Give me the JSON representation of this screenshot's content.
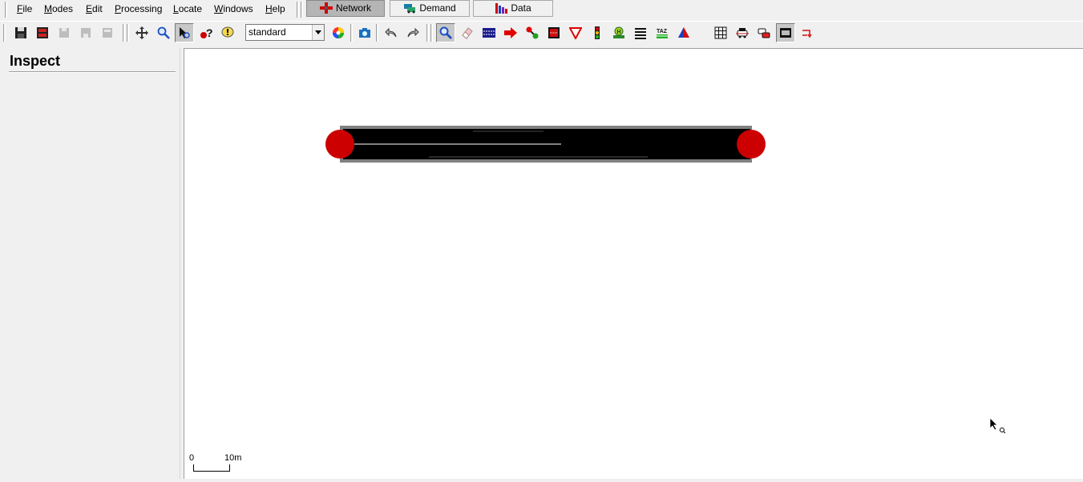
{
  "menu": {
    "items": [
      {
        "label": "File",
        "u": "F",
        "rest": "ile"
      },
      {
        "label": "Modes",
        "u": "M",
        "rest": "odes"
      },
      {
        "label": "Edit",
        "u": "E",
        "rest": "dit"
      },
      {
        "label": "Processing",
        "u": "P",
        "rest": "rocessing"
      },
      {
        "label": "Locate",
        "u": "L",
        "rest": "ocate"
      },
      {
        "label": "Windows",
        "u": "W",
        "rest": "indows"
      },
      {
        "label": "Help",
        "u": "H",
        "rest": "elp"
      }
    ]
  },
  "supermodes": {
    "network": "Network",
    "demand": "Demand",
    "data": "Data",
    "active": "Network"
  },
  "toolbar": {
    "scheme_value": "standard"
  },
  "inspect": {
    "title": "Inspect"
  },
  "canvas": {
    "scale_start": "0",
    "scale_end": "10m"
  },
  "colors": {
    "junction": "#cc0000",
    "road_surface": "#000000",
    "sidewalk": "#808080",
    "lane_marking": "#ffffff"
  }
}
